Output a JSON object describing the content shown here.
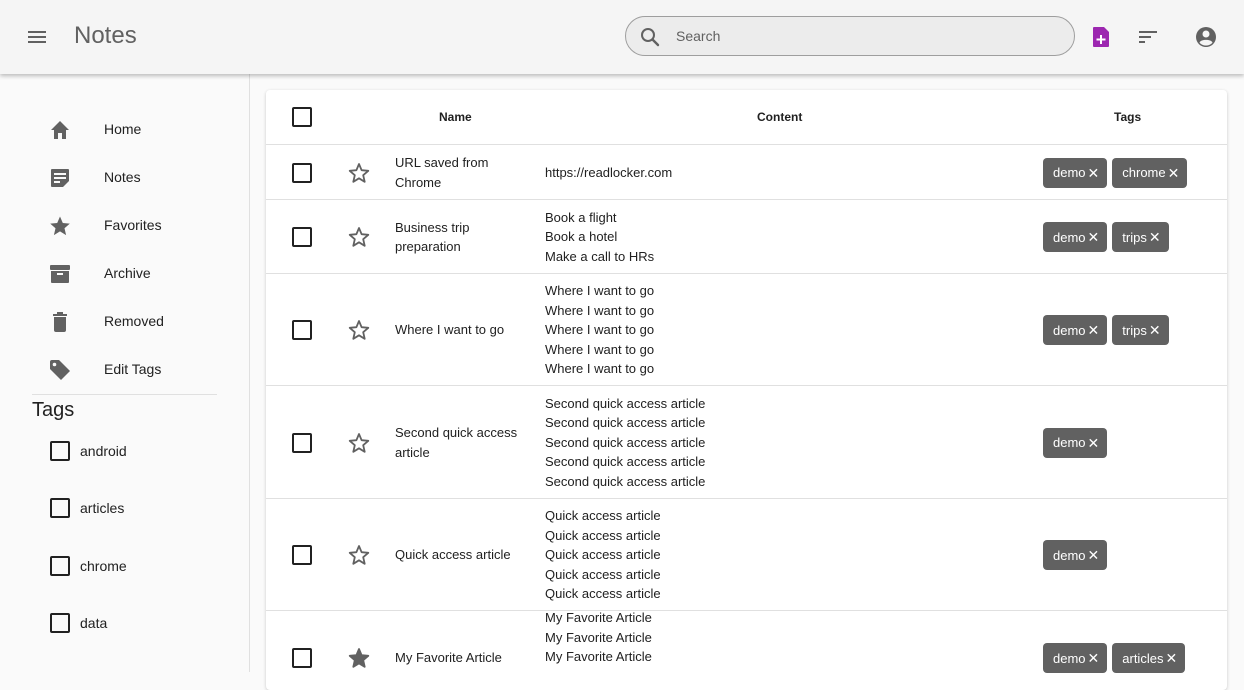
{
  "app": {
    "title": "Notes"
  },
  "search": {
    "placeholder": "Search"
  },
  "icons": {
    "menu": "menu-icon",
    "search": "search-icon",
    "new_note": "note-add-icon",
    "sort": "sort-icon",
    "account": "account-circle-icon",
    "star_outline": "star-outline-icon",
    "star_filled": "star-icon",
    "chip_remove": "close-icon"
  },
  "colors": {
    "accent": "#9c27b0",
    "chip": "#616161",
    "icon": "#616161"
  },
  "sidebar": {
    "nav": [
      {
        "label": "Home",
        "icon": "home-icon"
      },
      {
        "label": "Notes",
        "icon": "notes-icon"
      },
      {
        "label": "Favorites",
        "icon": "star-icon"
      },
      {
        "label": "Archive",
        "icon": "archive-icon"
      },
      {
        "label": "Removed",
        "icon": "trash-icon"
      },
      {
        "label": "Edit Tags",
        "icon": "tag-icon"
      }
    ],
    "tags_heading": "Tags",
    "tags": [
      {
        "label": "android",
        "checked": false
      },
      {
        "label": "articles",
        "checked": false
      },
      {
        "label": "chrome",
        "checked": false
      },
      {
        "label": "data",
        "checked": false
      }
    ]
  },
  "table": {
    "headers": {
      "name": "Name",
      "content": "Content",
      "tags": "Tags"
    },
    "chip_close": "✕",
    "rows": [
      {
        "name": "URL saved from Chrome",
        "favorite": false,
        "content": [
          "https://readlocker.com"
        ],
        "tags": [
          "demo",
          "chrome"
        ]
      },
      {
        "name": "Business trip preparation",
        "favorite": false,
        "content": [
          "Book a flight",
          "Book a hotel",
          "Make a call to HRs"
        ],
        "tags": [
          "demo",
          "trips"
        ]
      },
      {
        "name": "Where I want to go",
        "favorite": false,
        "content": [
          "Where I want to go",
          "Where I want to go",
          "Where I want to go",
          "Where I want to go",
          "Where I want to go"
        ],
        "tags": [
          "demo",
          "trips"
        ]
      },
      {
        "name": "Second quick access article",
        "favorite": false,
        "content": [
          "Second quick access article",
          "Second quick access article",
          "Second quick access article",
          "Second quick access article",
          "Second quick access article"
        ],
        "tags": [
          "demo"
        ]
      },
      {
        "name": "Quick access article",
        "favorite": false,
        "content": [
          "Quick access article",
          "Quick access article",
          "Quick access article",
          "Quick access article",
          "Quick access article"
        ],
        "tags": [
          "demo"
        ]
      },
      {
        "name": "My Favorite Article",
        "favorite": true,
        "content": [
          "My Favorite Article",
          "My Favorite Article",
          "My Favorite Article"
        ],
        "tags": [
          "demo",
          "articles"
        ]
      }
    ]
  }
}
